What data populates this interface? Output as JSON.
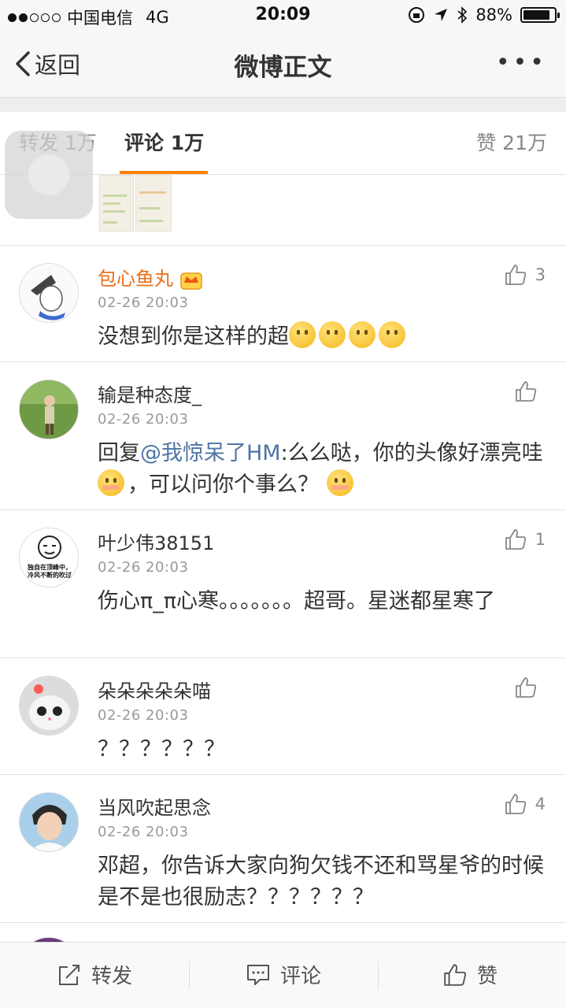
{
  "status_bar": {
    "carrier": "中国电信",
    "network": "4G",
    "time": "20:09",
    "battery": "88%",
    "battery_level": 0.88
  },
  "nav": {
    "back_label": "返回",
    "title": "微博正文",
    "more_label": "•••"
  },
  "tabs": {
    "repost": "转发 1万",
    "comment": "评论 1万",
    "like": "赞 21万"
  },
  "comments": [
    {
      "username": "包心鱼丸",
      "time": "02-26 20:03",
      "text": "没想到你是这样的超",
      "likes": "3"
    },
    {
      "username": "输是种态度_",
      "time": "02-26 20:03",
      "reply_prefix": "回复",
      "mention": "@我惊呆了HM",
      "text_a": ":么么哒，你的头像好漂亮哇",
      "text_b": "，可以问你个事么？",
      "likes": ""
    },
    {
      "username": "叶少伟38151",
      "time": "02-26 20:03",
      "text": "伤心π_π心寒。。。。。。。超哥。星迷都星寒了",
      "likes": "1",
      "avatar_text": "独自在顶峰中，冷风不断的吹过"
    },
    {
      "username": "朵朵朵朵朵喵",
      "time": "02-26 20:03",
      "text": "？？？？？？",
      "likes": ""
    },
    {
      "username": "当风吹起思念",
      "time": "02-26 20:03",
      "text": "邓超，你告诉大家向狗欠钱不还和骂星爷的时候是不是也很励志？？？？？？",
      "likes": "4"
    }
  ],
  "bottom_bar": {
    "repost": "转发",
    "comment": "评论",
    "like": "赞"
  },
  "colors": {
    "accent": "#ff8200",
    "vip_name": "#ea6f1a",
    "mention": "#4e74a6"
  },
  "icons": [
    "back-chevron-icon",
    "more-icon",
    "thumbs-up-icon",
    "crown-icon",
    "repost-icon",
    "comment-icon"
  ]
}
